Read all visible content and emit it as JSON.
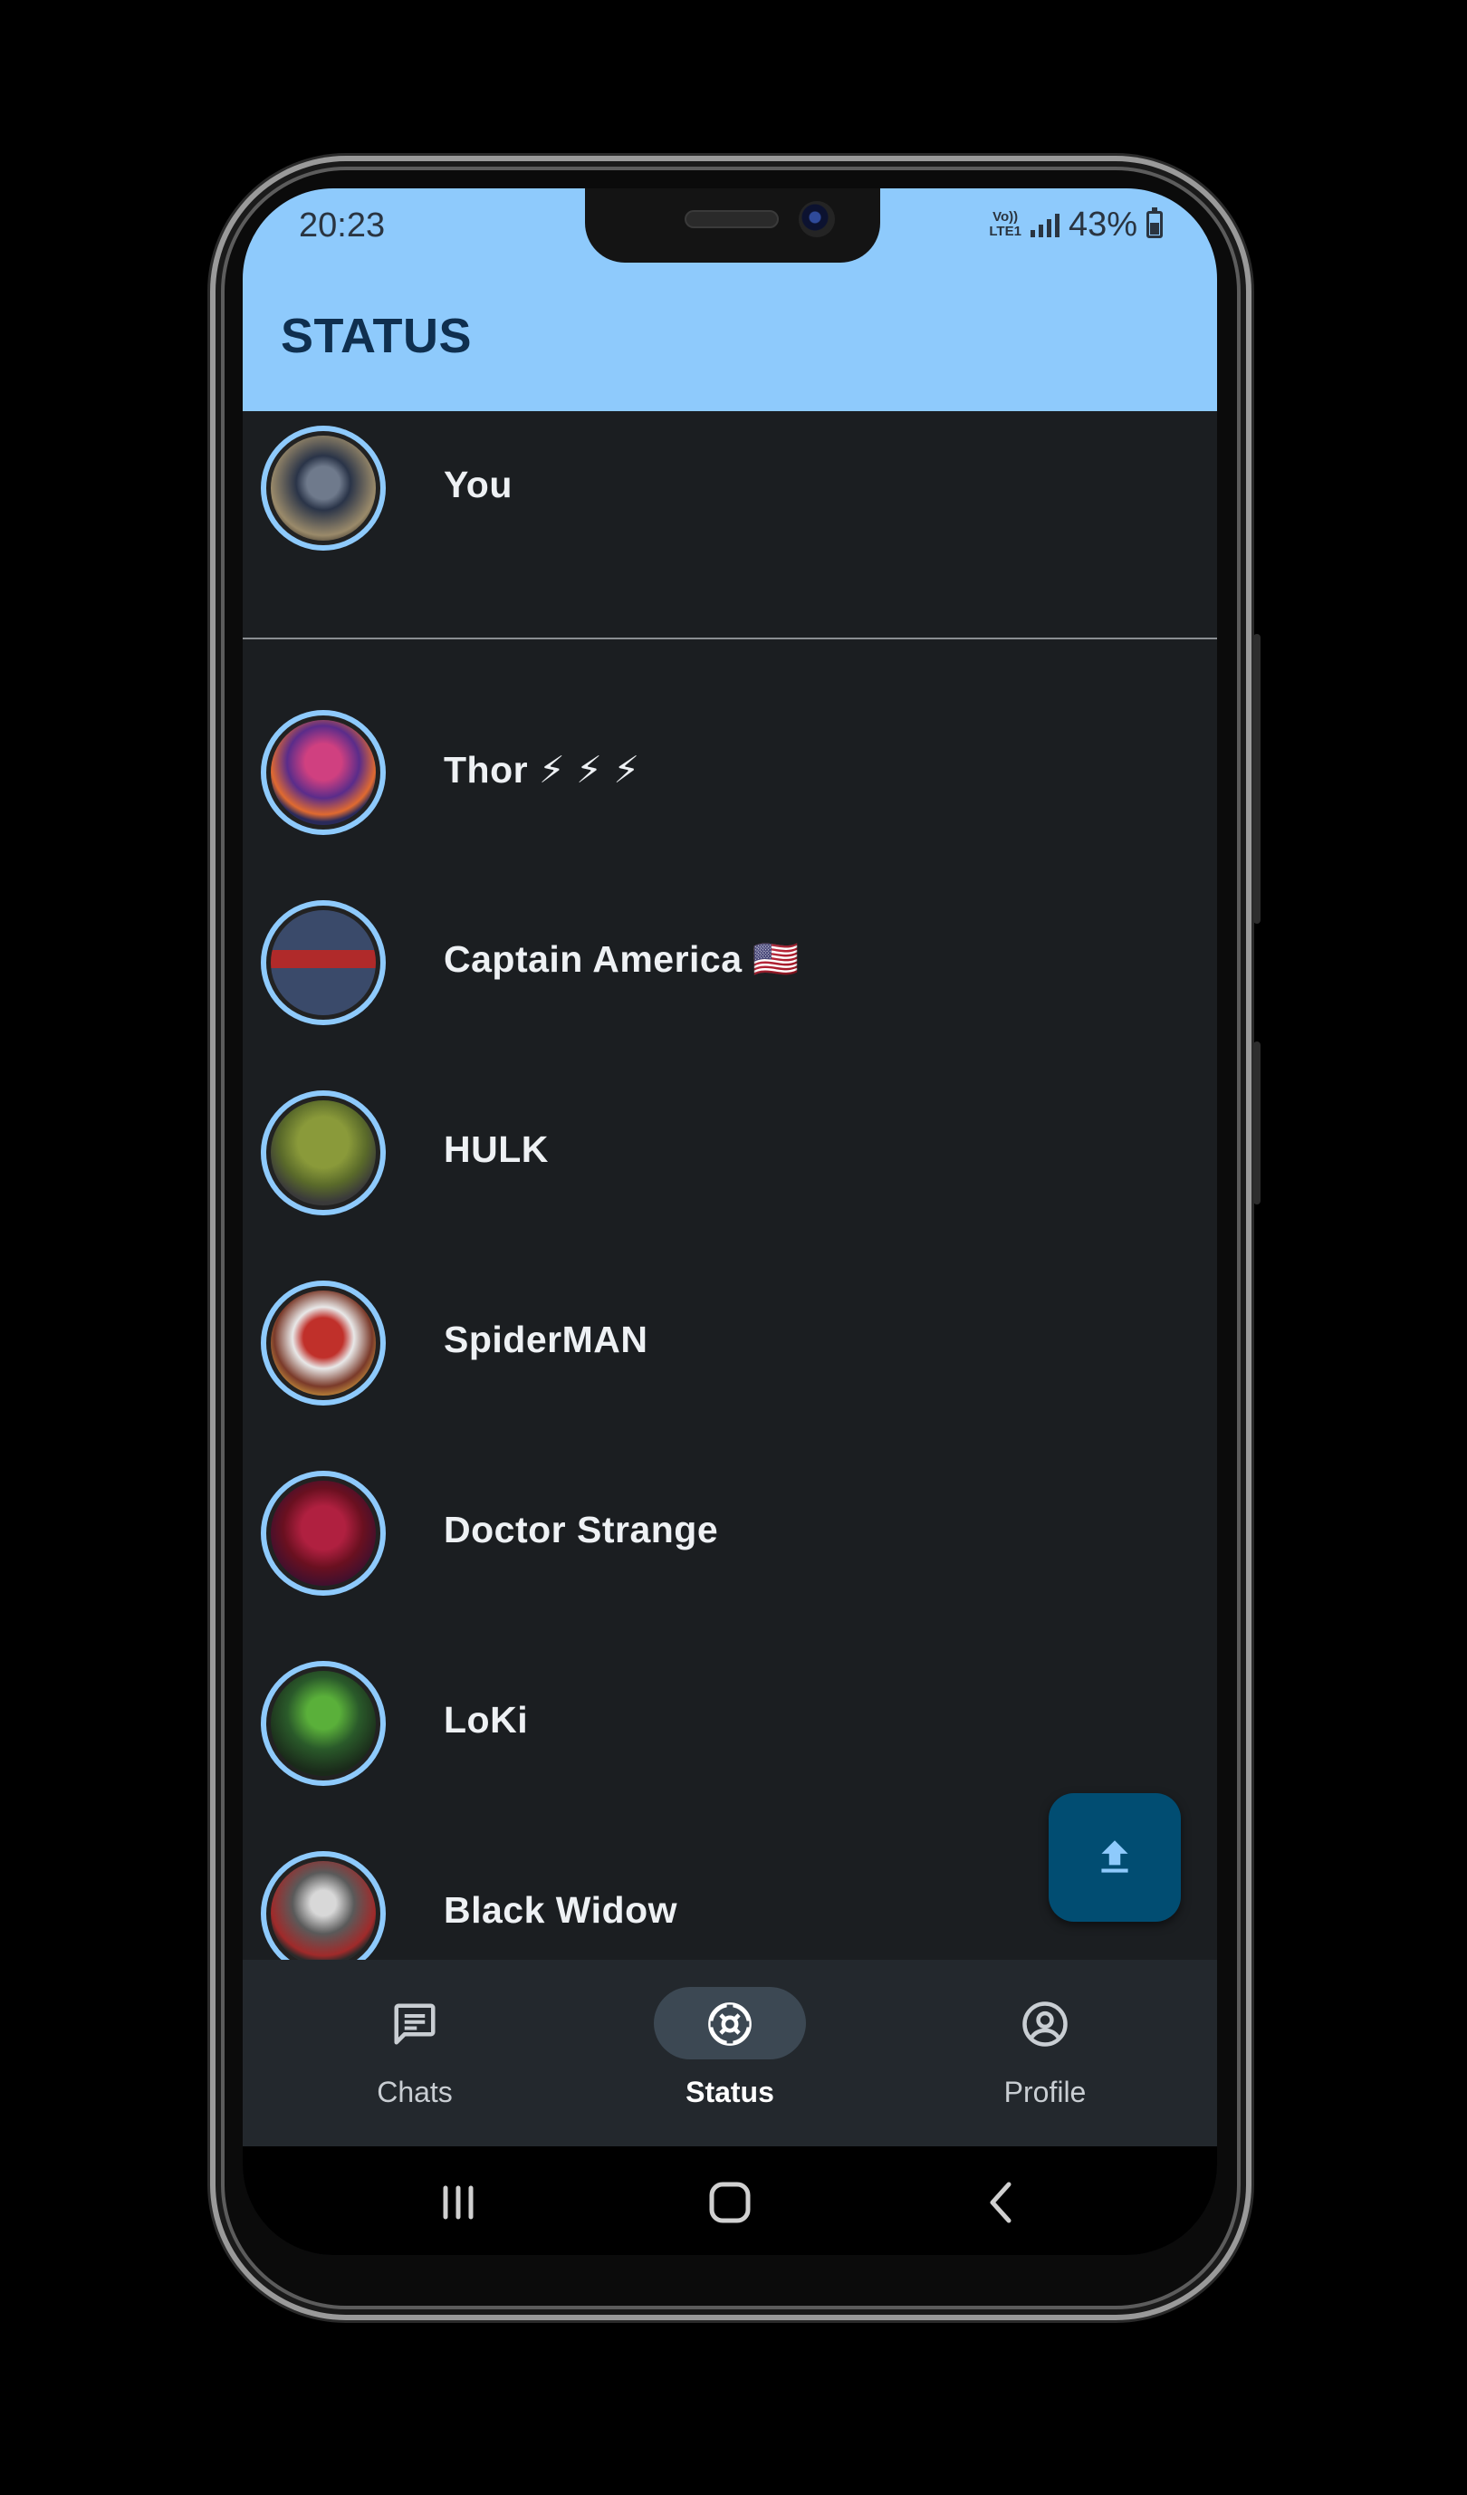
{
  "status_bar": {
    "time": "20:23",
    "volte_line1": "Vo))",
    "volte_line2": "LTE1",
    "battery_percent": "43%"
  },
  "app_bar": {
    "title": "STATUS"
  },
  "my_status": {
    "name": "You"
  },
  "contacts": [
    {
      "name": "Thor ⚡ ⚡ ⚡"
    },
    {
      "name": "Captain America 🇺🇸"
    },
    {
      "name": "HULK"
    },
    {
      "name": "SpiderMAN"
    },
    {
      "name": "Doctor Strange"
    },
    {
      "name": "LoKi"
    },
    {
      "name": "Black Widow"
    }
  ],
  "fab": {
    "icon": "upload-icon"
  },
  "bottom_nav": {
    "items": [
      {
        "label": "Chats",
        "icon": "chat-icon",
        "active": false
      },
      {
        "label": "Status",
        "icon": "status-icon",
        "active": true
      },
      {
        "label": "Profile",
        "icon": "account-circle-icon",
        "active": false
      }
    ]
  },
  "colors": {
    "accent": "#8ecafc",
    "background": "#1b1e21",
    "fab": "#014d72",
    "nav_bg": "#23282d"
  }
}
